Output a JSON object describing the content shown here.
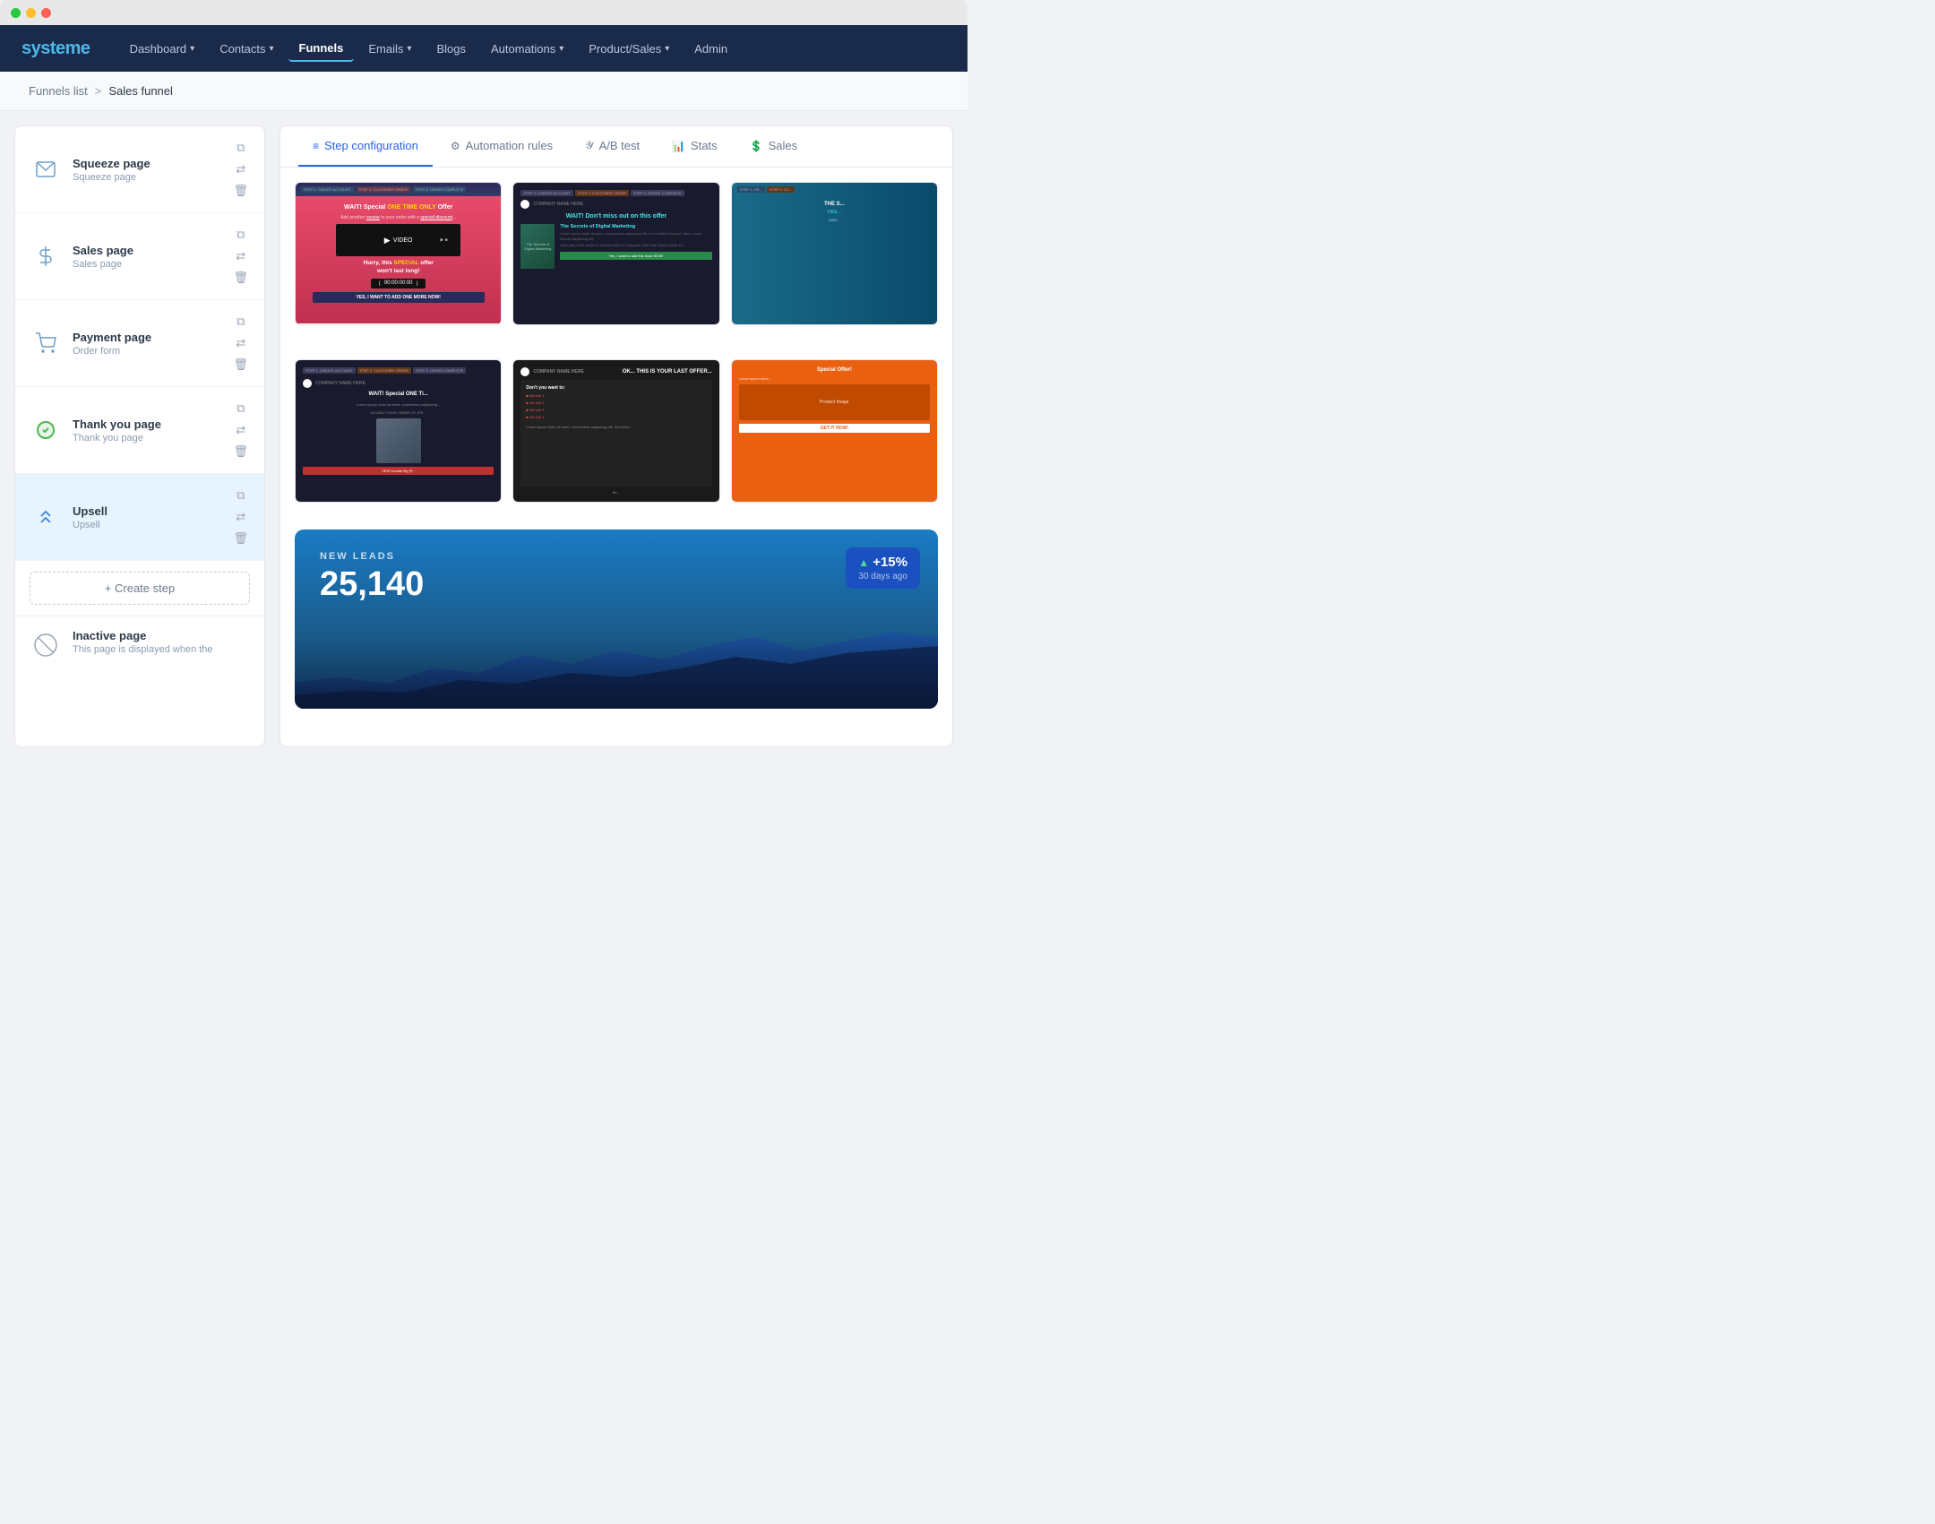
{
  "browser": {
    "dots": [
      "green",
      "yellow",
      "red"
    ]
  },
  "nav": {
    "logo": "systeme",
    "items": [
      {
        "label": "Dashboard",
        "has_caret": true,
        "active": false
      },
      {
        "label": "Contacts",
        "has_caret": true,
        "active": false
      },
      {
        "label": "Funnels",
        "has_caret": false,
        "active": true
      },
      {
        "label": "Emails",
        "has_caret": true,
        "active": false
      },
      {
        "label": "Blogs",
        "has_caret": false,
        "active": false
      },
      {
        "label": "Automations",
        "has_caret": true,
        "active": false
      },
      {
        "label": "Product/Sales",
        "has_caret": true,
        "active": false
      },
      {
        "label": "Admin",
        "has_caret": false,
        "active": false
      }
    ]
  },
  "breadcrumb": {
    "parent": "Funnels list",
    "separator": ">",
    "current": "Sales funnel"
  },
  "sidebar": {
    "steps": [
      {
        "id": "squeeze",
        "icon": "✉",
        "title": "Squeeze page",
        "subtitle": "Squeeze page"
      },
      {
        "id": "sales",
        "icon": "$",
        "title": "Sales page",
        "subtitle": "Sales page"
      },
      {
        "id": "payment",
        "icon": "🛒",
        "title": "Payment page",
        "subtitle": "Order form"
      },
      {
        "id": "thankyou",
        "icon": "✔",
        "title": "Thank you page",
        "subtitle": "Thank you page"
      },
      {
        "id": "upsell",
        "icon": "↑",
        "title": "Upsell",
        "subtitle": "Upsell",
        "active": true
      }
    ],
    "create_step_label": "+ Create step",
    "inactive_page": {
      "title": "Inactive page",
      "subtitle": "This page is displayed when the"
    }
  },
  "tabs": [
    {
      "id": "step-config",
      "icon": "≡",
      "label": "Step configuration",
      "active": true
    },
    {
      "id": "automation",
      "icon": "⚙",
      "label": "Automation rules",
      "active": false
    },
    {
      "id": "ab-test",
      "icon": "Y",
      "label": "A/B test",
      "active": false
    },
    {
      "id": "stats",
      "icon": "📊",
      "label": "Stats",
      "active": false
    },
    {
      "id": "sales",
      "icon": "$",
      "label": "Sales",
      "active": false
    }
  ],
  "templates": [
    {
      "id": "tmpl-pink-upsell",
      "type": "pink",
      "headline": "WAIT! Special ONE TIME ONLY Offer",
      "subtext": "Add another course to your order with a special discount...",
      "offer_text": "Hurry, this SPECIAL offer won't last long!",
      "button_text": "YES, I WANT TO ADD ONE MORE NOW!"
    },
    {
      "id": "tmpl-dark-book",
      "type": "dark",
      "wait_text": "WAIT! Don't miss out on this offer",
      "book_title": "The Secrets of Digital Marketing"
    },
    {
      "id": "tmpl-blue-book",
      "type": "blue",
      "partial": true
    },
    {
      "id": "tmpl-dark2",
      "type": "dark2",
      "headline": "WAIT! Special ONE TI...",
      "subtitle": "Lorem ipsum dolor sit amet..."
    },
    {
      "id": "tmpl-last-offer",
      "type": "last-offer",
      "text": "OK... THIS IS YOUR LAST OFFER..."
    },
    {
      "id": "tmpl-orange",
      "type": "orange"
    }
  ],
  "stats_overlay": {
    "label": "NEW LEADS",
    "value": "25,140",
    "badge": {
      "trend": "▲",
      "percent": "+15%",
      "period": "30 days ago"
    }
  }
}
